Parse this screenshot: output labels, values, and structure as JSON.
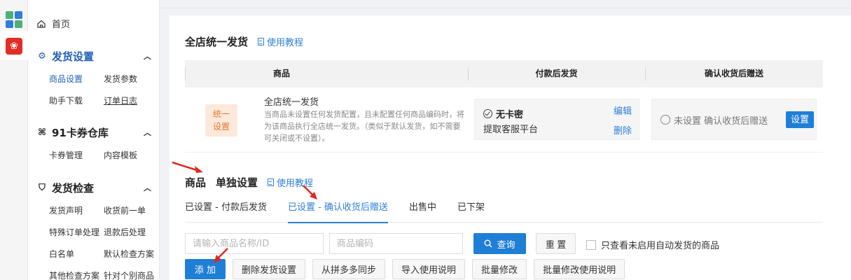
{
  "colors": {
    "accent": "#1f7fd6",
    "link": "#2f7fd8",
    "arrow": "#e0281f",
    "badge_bg": "#fde8dc",
    "badge_text": "#e8782a"
  },
  "rail": {
    "icons": [
      "grid-app-icon",
      "pdd-app-icon"
    ]
  },
  "sidebar": {
    "home": "首页",
    "sections": [
      {
        "title": "发货设置",
        "icon": "settings-gear-icon",
        "items": [
          "商品设置",
          "发货参数",
          "助手下载",
          "订单日志"
        ]
      },
      {
        "title": "91卡券仓库",
        "icon": "grid-icon",
        "items": [
          "卡券管理",
          "内容模板"
        ]
      },
      {
        "title": "发货检查",
        "icon": "shield-icon",
        "items": [
          "发货声明",
          "收货前一单",
          "特殊订单处理",
          "退款后处理",
          "白名单",
          "默认检查方案",
          "其他检查方案",
          "针对个别商品"
        ]
      }
    ]
  },
  "store": {
    "title": "全店统一发货",
    "tutorial": "使用教程",
    "columns": [
      "商品",
      "付款后发货",
      "确认收货后赠送"
    ],
    "row": {
      "badge": "统一设置",
      "name": "全店统一发货",
      "desc": "当商品未设置任何发货配置，且未配置任何商品编码时，将为该商品执行全店统一发货。（类似于默认发货，如不需要可关闭或不设置）。",
      "mode": "无卡密",
      "mode_sub": "提取客服平台",
      "edit": "编辑",
      "delete": "删除",
      "gift_status": "未设置 确认收货后赠送",
      "set": "设置"
    }
  },
  "single": {
    "title_a": "商品",
    "title_b": "单独设置",
    "tutorial": "使用教程",
    "tabs": [
      "已设置 - 付款后发货",
      "已设置 - 确认收货后赠送",
      "出售中",
      "已下架"
    ],
    "active_tab": 1
  },
  "filters": {
    "name_placeholder": "请输入商品名称/ID",
    "code_placeholder": "商品编码",
    "search": "查询",
    "reset": "重 置",
    "only_disabled": "只查看未启用自动发货的商品"
  },
  "actions": [
    "添 加",
    "删除发货设置",
    "从拼多多同步",
    "导入使用说明",
    "批量修改",
    "批量修改使用说明"
  ]
}
